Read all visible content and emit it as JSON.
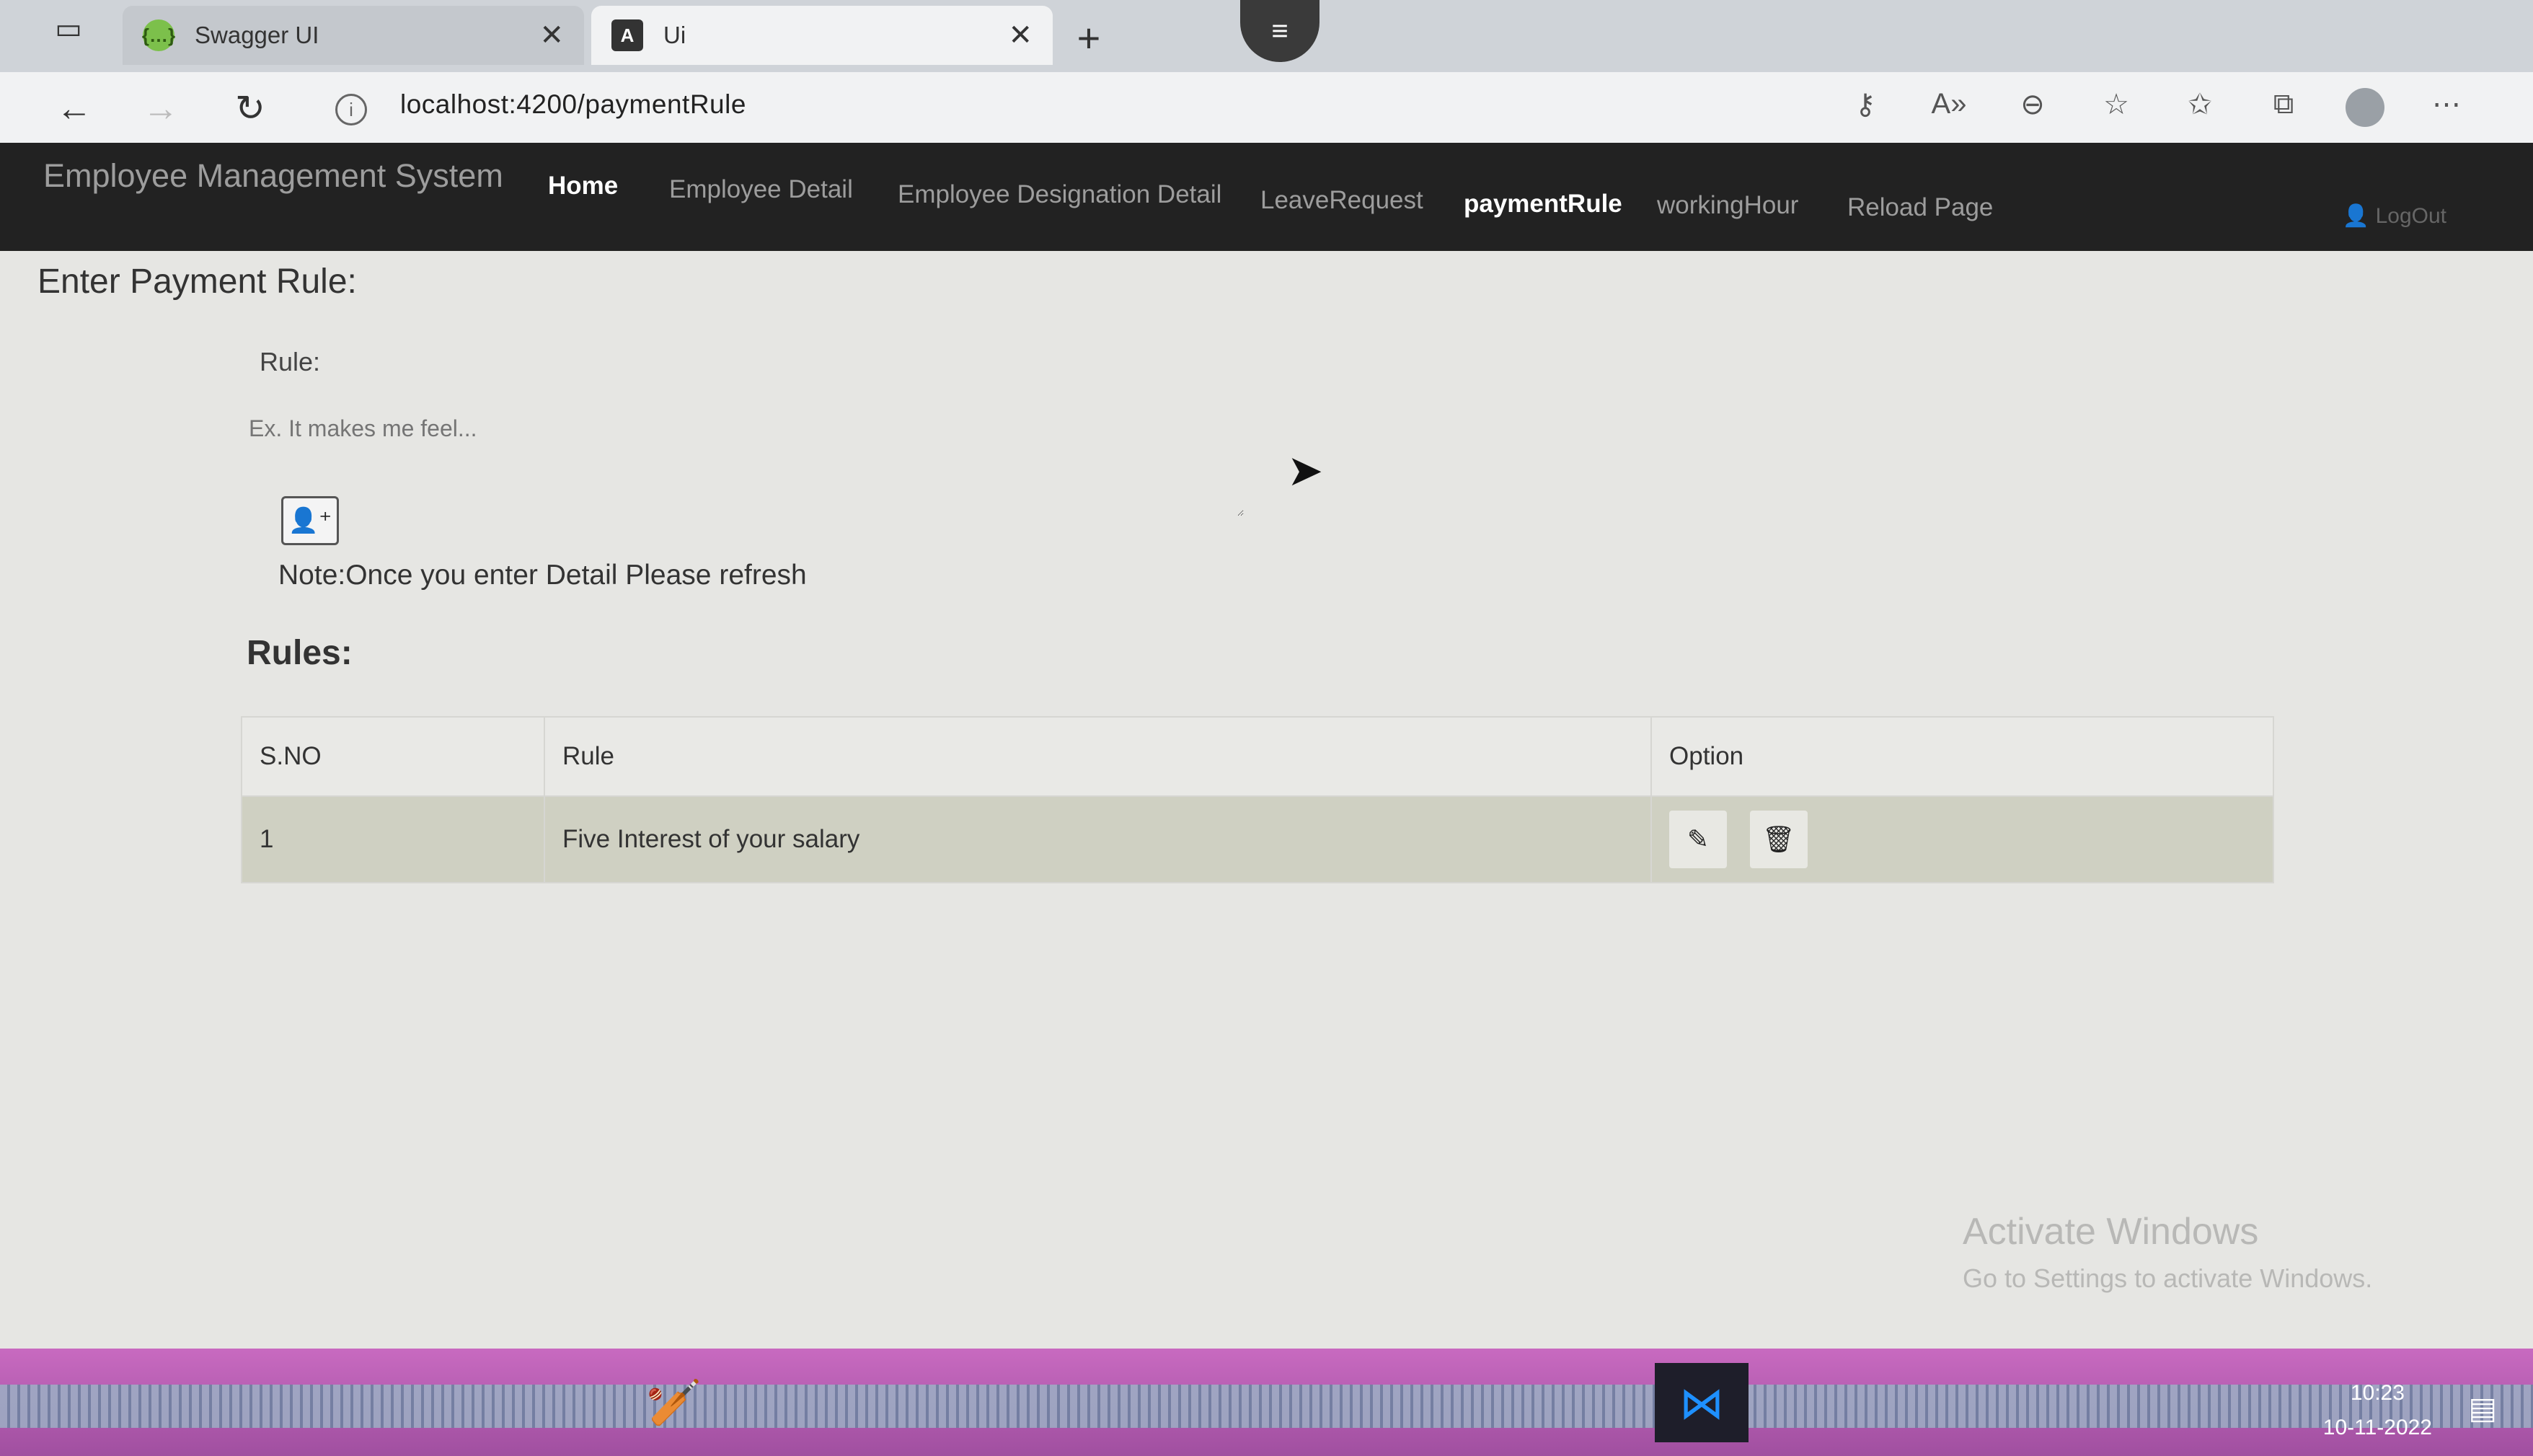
{
  "browser": {
    "tabs": [
      {
        "title": "Swagger UI",
        "favicon": "swagger-icon",
        "active": false
      },
      {
        "title": "Ui",
        "favicon": "angular-icon",
        "active": true
      }
    ],
    "url": "localhost:4200/paymentRule"
  },
  "navbar": {
    "brand": "Employee Management System",
    "links": [
      {
        "label": "Home",
        "emphasis": true
      },
      {
        "label": "Employee Detail",
        "emphasis": false
      },
      {
        "label": "Employee Designation Detail",
        "emphasis": false
      },
      {
        "label": "LeaveRequest",
        "emphasis": false
      },
      {
        "label": "paymentRule",
        "emphasis": true
      },
      {
        "label": "workingHour",
        "emphasis": false
      },
      {
        "label": "Reload Page",
        "emphasis": false
      }
    ],
    "logout": "LogOut"
  },
  "form": {
    "title": "Enter Payment Rule:",
    "rule_label": "Rule:",
    "rule_placeholder": "Ex. It makes me feel...",
    "note": "Note:Once you enter Detail Please refresh"
  },
  "rules": {
    "title": "Rules:",
    "columns": [
      "S.NO",
      "Rule",
      "Option"
    ],
    "rows": [
      {
        "sno": "1",
        "rule": "Five Interest of your salary"
      }
    ]
  },
  "watermark": {
    "line1": "Activate Windows",
    "line2": "Go to Settings to activate Windows."
  },
  "taskbar": {
    "time": "10:23",
    "date": "10-11-2022"
  },
  "colors": {
    "navbar_bg": "#222222",
    "page_bg": "#e6e6e3",
    "row_bg": "#cfd0c2"
  }
}
